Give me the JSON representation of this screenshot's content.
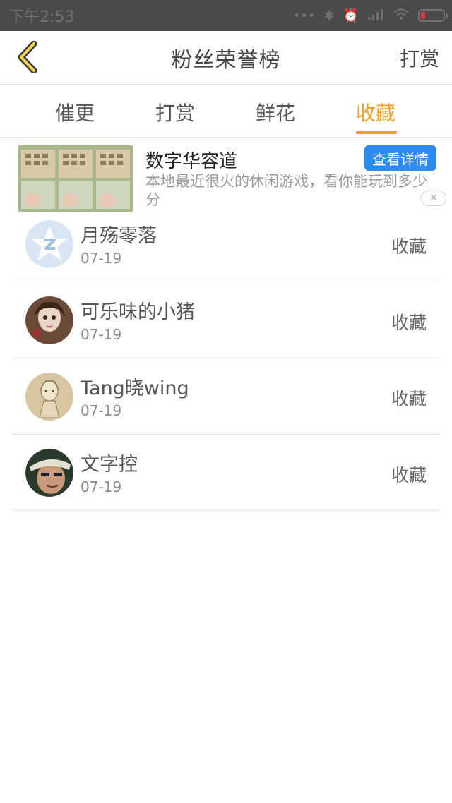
{
  "status_bar": {
    "time": "下午2:53"
  },
  "nav": {
    "title": "粉丝荣誉榜",
    "right_label": "打赏"
  },
  "tabs": [
    {
      "label": "催更"
    },
    {
      "label": "打赏"
    },
    {
      "label": "鲜花"
    },
    {
      "label": "收藏",
      "active": true
    }
  ],
  "ad": {
    "title": "数字华容道",
    "button_label": "查看详情",
    "description": "本地最近很火的休闲游戏，看你能玩到多少分"
  },
  "list": [
    {
      "name": "月殇零落",
      "date": "07-19",
      "action": "收藏"
    },
    {
      "name": "可乐味的小猪",
      "date": "07-19",
      "action": "收藏"
    },
    {
      "name": "Tang晓wing",
      "date": "07-19",
      "action": "收藏"
    },
    {
      "name": "文字控",
      "date": "07-19",
      "action": "收藏"
    }
  ],
  "colors": {
    "accent": "#f0a020",
    "ad_button": "#2d8cf0",
    "status_bar": "#4a4a4a"
  }
}
